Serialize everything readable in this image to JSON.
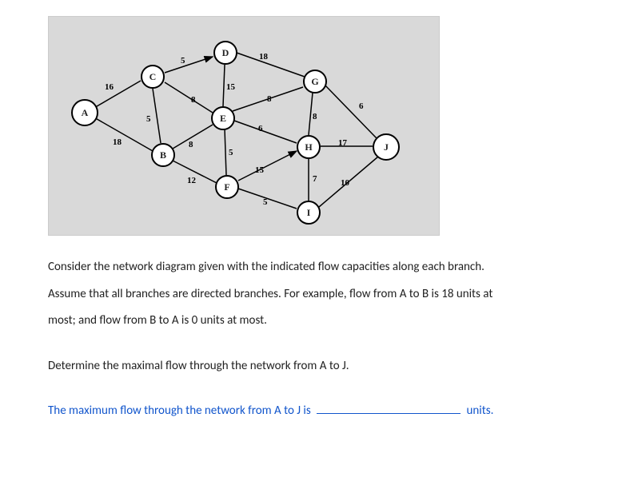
{
  "diagram": {
    "nodes": {
      "A": "A",
      "B": "B",
      "C": "C",
      "D": "D",
      "E": "E",
      "F": "F",
      "G": "G",
      "H": "H",
      "I": "I",
      "J": "J"
    },
    "edge_capacities": {
      "A_C": "16",
      "A_B": "18",
      "C_D": "5",
      "C_B": "5",
      "C_E": "8",
      "D_E": "15",
      "D_G": "18",
      "B_E": "8",
      "B_F": "12",
      "E_G": "8",
      "E_F": "5",
      "E_H": "6",
      "F_H": "15",
      "F_I": "5",
      "G_H": "8",
      "G_J": "6",
      "H_J": "17",
      "I_H": "7",
      "I_J": "10"
    }
  },
  "text": {
    "p1": "Consider the network diagram given with the indicated flow capacities along each branch.",
    "p2": "Assume that all branches are directed branches. For example, flow from A to B is 18 units at",
    "p3": "most; and flow from B to A is 0 units at most.",
    "q": "Determine the maximal flow through the network from A to J.",
    "ans_pre": "The maximum flow through the network from A to J is",
    "ans_post": "units."
  }
}
